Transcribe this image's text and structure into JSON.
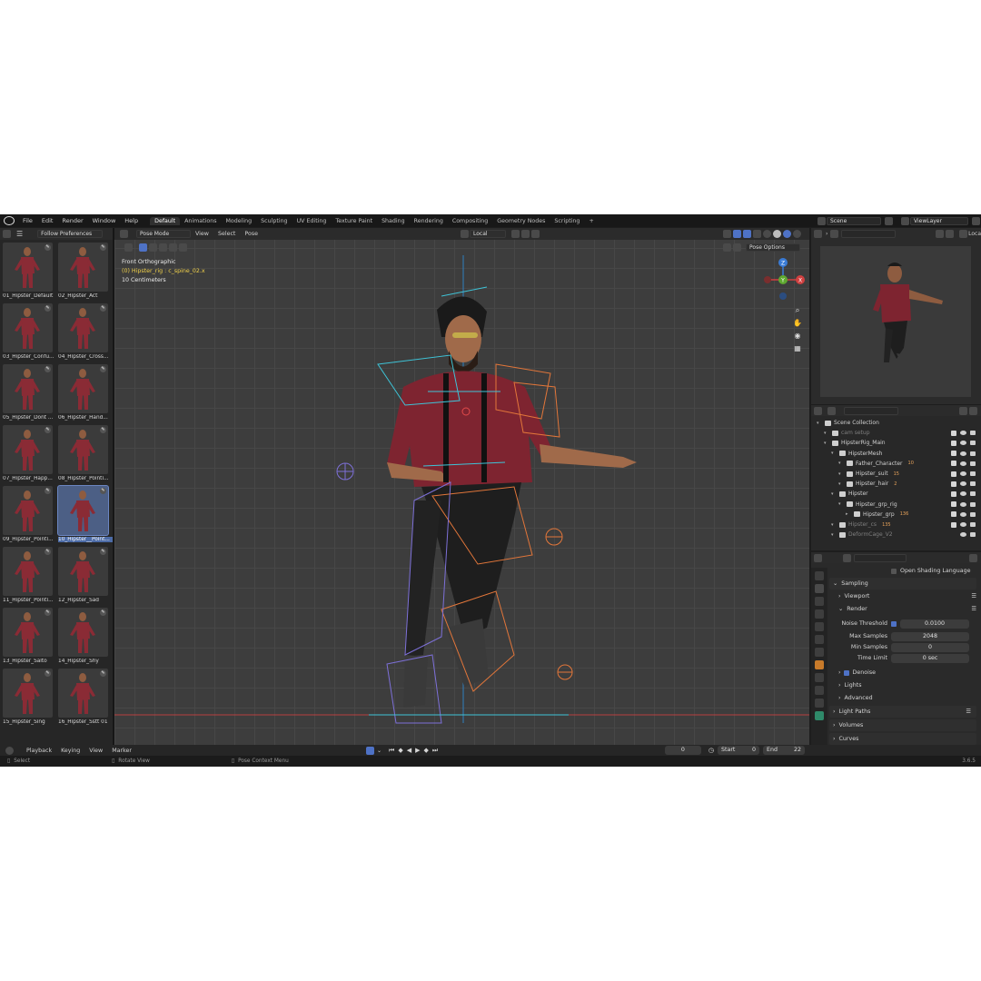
{
  "topbar": {
    "menus": [
      "File",
      "Edit",
      "Render",
      "Window",
      "Help"
    ],
    "workspaces": [
      "Default",
      "Animations",
      "Modeling",
      "Sculpting",
      "UV Editing",
      "Texture Paint",
      "Shading",
      "Rendering",
      "Compositing",
      "Geometry Nodes",
      "Scripting"
    ],
    "active_workspace": "Default",
    "add_tab": "+",
    "scene": "Scene",
    "view_layer": "ViewLayer"
  },
  "browser": {
    "dropdown": "Follow Preferences",
    "items": [
      {
        "label": "01_Hipster_Default"
      },
      {
        "label": "02_Hipster_Act"
      },
      {
        "label": "03_Hipster_Confu..."
      },
      {
        "label": "04_Hipster_Cross..."
      },
      {
        "label": "05_Hipster_Dont ..."
      },
      {
        "label": "06_Hipster_Hand..."
      },
      {
        "label": "07_Hipster_Happ..."
      },
      {
        "label": "08_Hipster_Pointi..."
      },
      {
        "label": "09_Hipster_Pointi..."
      },
      {
        "label": "10_Hipster__Point..."
      },
      {
        "label": "11_Hipster_Pointi..."
      },
      {
        "label": "12_Hipster_Sad"
      },
      {
        "label": "13_Hipster_Salto"
      },
      {
        "label": "14_Hipster_Shy"
      },
      {
        "label": "15_Hipster_Sing"
      },
      {
        "label": "16_Hipster_Sstt 01"
      }
    ],
    "selected_index": 9
  },
  "viewport": {
    "mode": "Pose Mode",
    "menus": [
      "View",
      "Select",
      "Pose"
    ],
    "orientation": "Local",
    "pose_options": "Pose Options",
    "view_name": "Front Orthographic",
    "active_bone": "(0) Hipster_rig : c_spine_02.x",
    "scale": "10 Centimeters",
    "gizmo": {
      "z": "Z",
      "x": "X",
      "y": "Y"
    }
  },
  "outliner": {
    "local_label": "Loca",
    "rows": [
      {
        "label": "Scene Collection",
        "indent": 0,
        "dim": false,
        "check": false
      },
      {
        "label": "cam setup",
        "indent": 1,
        "dim": true,
        "check": true
      },
      {
        "label": "HipsterRig_Main",
        "indent": 1,
        "dim": false,
        "check": true
      },
      {
        "label": "HipsterMesh",
        "indent": 2,
        "dim": false,
        "check": true
      },
      {
        "label": "Father_Character",
        "indent": 3,
        "dim": false,
        "check": true,
        "badge": "10"
      },
      {
        "label": "Hipster_suit",
        "indent": 3,
        "dim": false,
        "check": true,
        "badge": "15"
      },
      {
        "label": "Hipster_hair",
        "indent": 3,
        "dim": false,
        "check": true,
        "badge": "2"
      },
      {
        "label": "Hipster",
        "indent": 2,
        "dim": false,
        "check": true
      },
      {
        "label": "Hipster_grp_rig",
        "indent": 3,
        "dim": false,
        "check": true
      },
      {
        "label": "Hipster_grp",
        "indent": 4,
        "dim": false,
        "check": true,
        "badge": "136"
      },
      {
        "label": "Hipster_cs",
        "indent": 2,
        "dim": true,
        "check": true,
        "badge": "135"
      },
      {
        "label": "DeformCage_V2",
        "indent": 2,
        "dim": true,
        "check": false
      }
    ]
  },
  "properties": {
    "open_shading_language": "Open Shading Language",
    "sampling": "Sampling",
    "viewport": "Viewport",
    "render": "Render",
    "noise_threshold_label": "Noise Threshold",
    "noise_threshold": "0.0100",
    "max_samples_label": "Max Samples",
    "max_samples": "2048",
    "min_samples_label": "Min Samples",
    "min_samples": "0",
    "time_limit_label": "Time Limit",
    "time_limit": "0 sec",
    "denoise": "Denoise",
    "lights": "Lights",
    "advanced": "Advanced",
    "light_paths": "Light Paths",
    "volumes": "Volumes",
    "curves": "Curves"
  },
  "timeline": {
    "menus": [
      "Playback",
      "Keying",
      "View",
      "Marker"
    ],
    "current_frame": "0",
    "start_label": "Start",
    "start": "0",
    "end_label": "End",
    "end": "22"
  },
  "statusbar": {
    "select": "Select",
    "rotate": "Rotate View",
    "context": "Pose Context Menu",
    "version": "3.6.5"
  },
  "colors": {
    "accent": "#4e72c6",
    "selected": "#4c6ba6",
    "shirt": "#8a2b35",
    "orange_bones": "#e2763a",
    "cyan_bones": "#3ec4d8",
    "purple_bones": "#7d70d8"
  }
}
